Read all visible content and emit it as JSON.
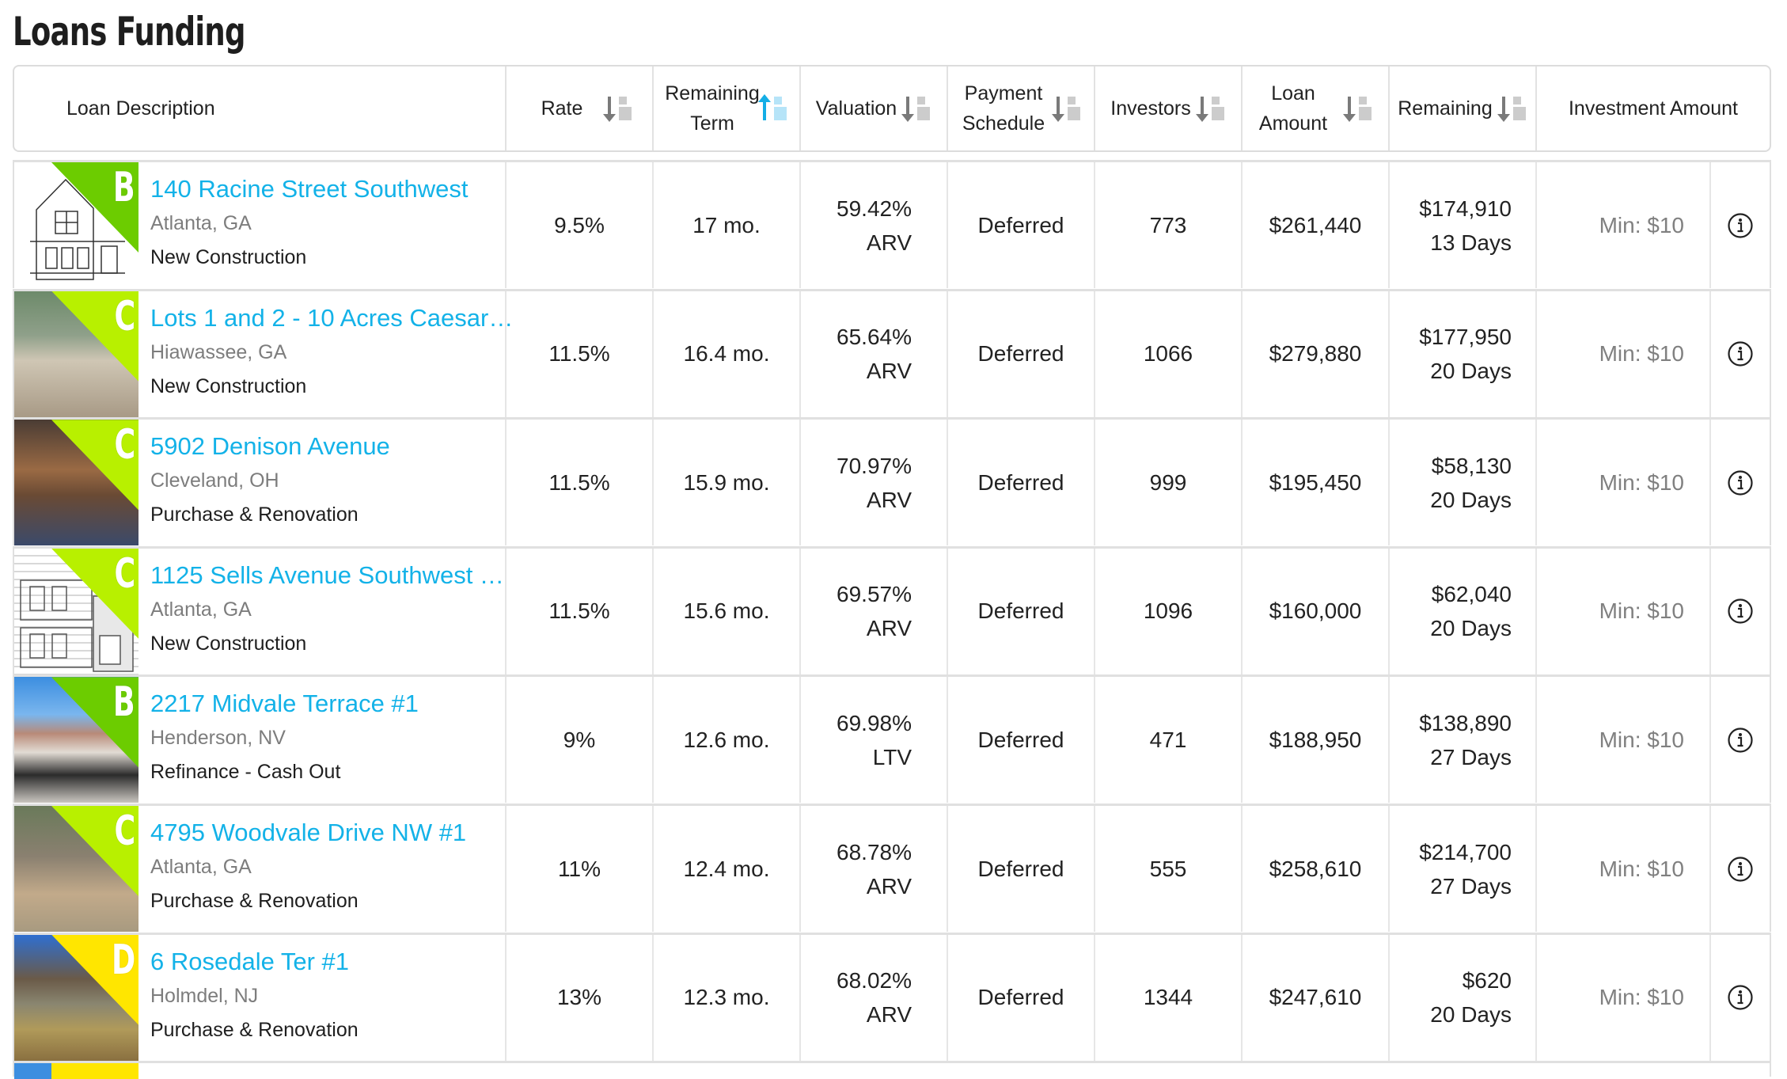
{
  "page": {
    "title": "Loans Funding"
  },
  "colors": {
    "link": "#13b2e8",
    "grade_B": "#6ccc00",
    "grade_C": "#b8f000",
    "grade_D": "#ffe600",
    "sort_active": "#14aee6",
    "sort_inactive": "#7a7a7a"
  },
  "columns": [
    {
      "label": "Loan Description",
      "sortable": false
    },
    {
      "label": "Rate",
      "sortable": true,
      "sort_icon": "sort-desc-icon",
      "active": false
    },
    {
      "label": "Remaining Term",
      "sortable": true,
      "sort_icon": "sort-asc-icon",
      "active": true
    },
    {
      "label": "Valuation",
      "sortable": true,
      "sort_icon": "sort-desc-icon",
      "active": false
    },
    {
      "label": "Payment Schedule",
      "sortable": true,
      "sort_icon": "sort-desc-icon",
      "active": false
    },
    {
      "label": "Investors",
      "sortable": true,
      "sort_icon": "sort-desc-icon",
      "active": false
    },
    {
      "label": "Loan Amount",
      "sortable": true,
      "sort_icon": "sort-desc-icon",
      "active": false
    },
    {
      "label": "Remaining",
      "sortable": true,
      "sort_icon": "sort-desc-icon",
      "active": false
    },
    {
      "label": "Investment Amount",
      "sortable": false
    }
  ],
  "loans": [
    {
      "grade": "B",
      "title": "140 Racine Street Southwest",
      "location": "Atlanta, GA",
      "type": "New Construction",
      "rate": "9.5%",
      "term": "17 mo.",
      "valuation_pct": "59.42%",
      "valuation_basis": "ARV",
      "schedule": "Deferred",
      "investors": "773",
      "loan_amount": "$261,440",
      "remaining_amount": "$174,910",
      "remaining_days": "13 Days",
      "min": "Min: $10",
      "thumb": "sketch"
    },
    {
      "grade": "C",
      "title": "Lots 1 and 2 - 10 Acres Caesar …",
      "location": "Hiawassee, GA",
      "type": "New Construction",
      "rate": "11.5%",
      "term": "16.4 mo.",
      "valuation_pct": "65.64%",
      "valuation_basis": "ARV",
      "schedule": "Deferred",
      "investors": "1066",
      "loan_amount": "$279,880",
      "remaining_amount": "$177,950",
      "remaining_days": "20 Days",
      "min": "Min: $10",
      "thumb": "photo1"
    },
    {
      "grade": "C",
      "title": "5902 Denison Avenue",
      "location": "Cleveland, OH",
      "type": "Purchase & Renovation",
      "rate": "11.5%",
      "term": "15.9 mo.",
      "valuation_pct": "70.97%",
      "valuation_basis": "ARV",
      "schedule": "Deferred",
      "investors": "999",
      "loan_amount": "$195,450",
      "remaining_amount": "$58,130",
      "remaining_days": "20 Days",
      "min": "Min: $10",
      "thumb": "photo2"
    },
    {
      "grade": "C",
      "title": "1125 Sells Avenue Southwest …",
      "location": "Atlanta, GA",
      "type": "New Construction",
      "rate": "11.5%",
      "term": "15.6 mo.",
      "valuation_pct": "69.57%",
      "valuation_basis": "ARV",
      "schedule": "Deferred",
      "investors": "1096",
      "loan_amount": "$160,000",
      "remaining_amount": "$62,040",
      "remaining_days": "20 Days",
      "min": "Min: $10",
      "thumb": "sketch2"
    },
    {
      "grade": "B",
      "title": "2217 Midvale Terrace #1",
      "location": "Henderson, NV",
      "type": "Refinance - Cash Out",
      "rate": "9%",
      "term": "12.6 mo.",
      "valuation_pct": "69.98%",
      "valuation_basis": "LTV",
      "schedule": "Deferred",
      "investors": "471",
      "loan_amount": "$188,950",
      "remaining_amount": "$138,890",
      "remaining_days": "27 Days",
      "min": "Min: $10",
      "thumb": "photo3"
    },
    {
      "grade": "C",
      "title": "4795 Woodvale Drive NW #1",
      "location": "Atlanta, GA",
      "type": "Purchase & Renovation",
      "rate": "11%",
      "term": "12.4 mo.",
      "valuation_pct": "68.78%",
      "valuation_basis": "ARV",
      "schedule": "Deferred",
      "investors": "555",
      "loan_amount": "$258,610",
      "remaining_amount": "$214,700",
      "remaining_days": "27 Days",
      "min": "Min: $10",
      "thumb": "photo4"
    },
    {
      "grade": "D",
      "title": "6 Rosedale Ter #1",
      "location": "Holmdel, NJ",
      "type": "Purchase & Renovation",
      "rate": "13%",
      "term": "12.3 mo.",
      "valuation_pct": "68.02%",
      "valuation_basis": "ARV",
      "schedule": "Deferred",
      "investors": "1344",
      "loan_amount": "$247,610",
      "remaining_amount": "$620",
      "remaining_days": "20 Days",
      "min": "Min: $10",
      "thumb": "photo5"
    }
  ]
}
